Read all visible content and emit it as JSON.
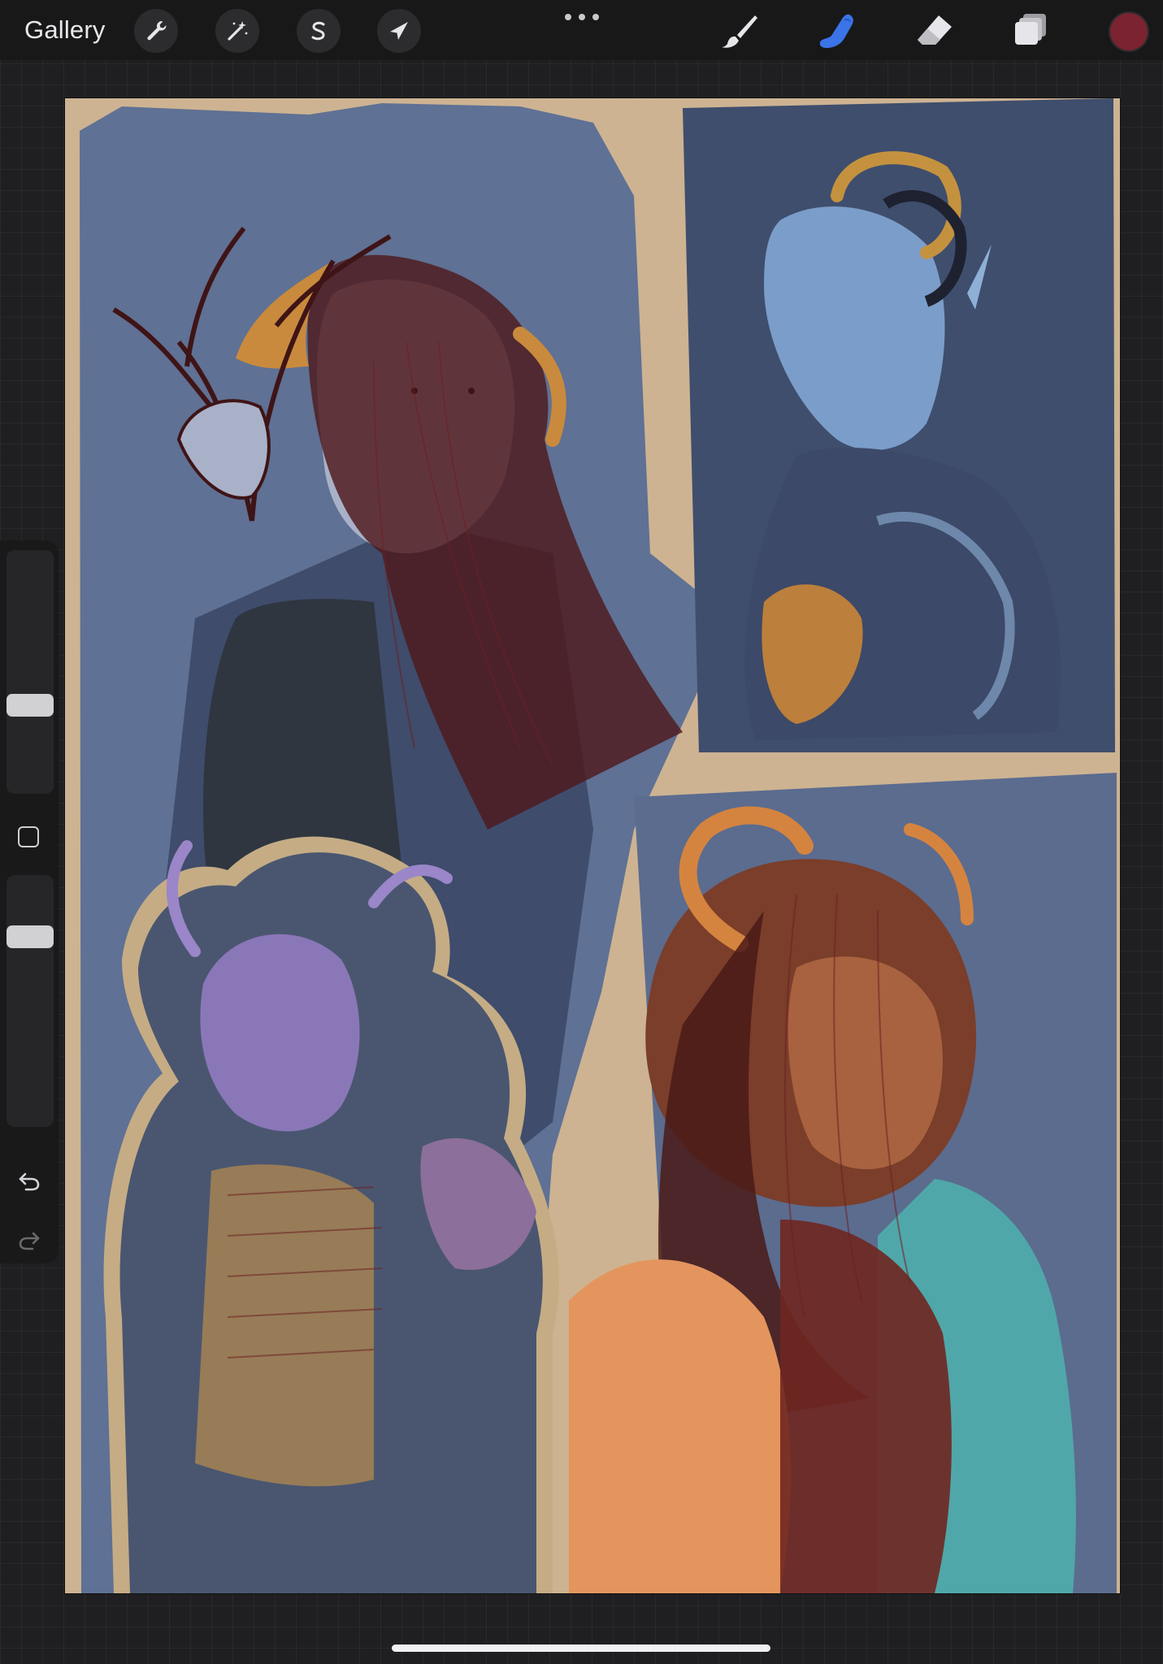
{
  "toolbar": {
    "gallery_label": "Gallery",
    "left_tools": [
      {
        "name": "actions",
        "icon": "wrench-icon"
      },
      {
        "name": "adjustments",
        "icon": "magic-wand-icon"
      },
      {
        "name": "selection",
        "icon": "selection-s-icon"
      },
      {
        "name": "transform",
        "icon": "arrow-cursor-icon"
      }
    ],
    "more_icon": "ellipsis-icon",
    "right_tools": [
      {
        "name": "brush",
        "icon": "brush-icon",
        "active": false
      },
      {
        "name": "smudge",
        "icon": "smudge-finger-icon",
        "active": true
      },
      {
        "name": "eraser",
        "icon": "eraser-icon",
        "active": false
      },
      {
        "name": "layers",
        "icon": "layers-icon",
        "active": false
      }
    ],
    "current_color": "#7b2330",
    "accent_color": "#3a74e8"
  },
  "sidebar": {
    "brush_size_level": 0.35,
    "opacity_level": 0.78,
    "modify_icon": "square-outline-icon",
    "undo_icon": "undo-icon",
    "redo_icon": "redo-icon"
  },
  "canvas": {
    "background_color": "#cdb392",
    "palette": [
      "#5d6f91",
      "#3f4d6b",
      "#6e1f22",
      "#c9893f",
      "#e4955d",
      "#9a86c8",
      "#4fb2ae"
    ]
  }
}
